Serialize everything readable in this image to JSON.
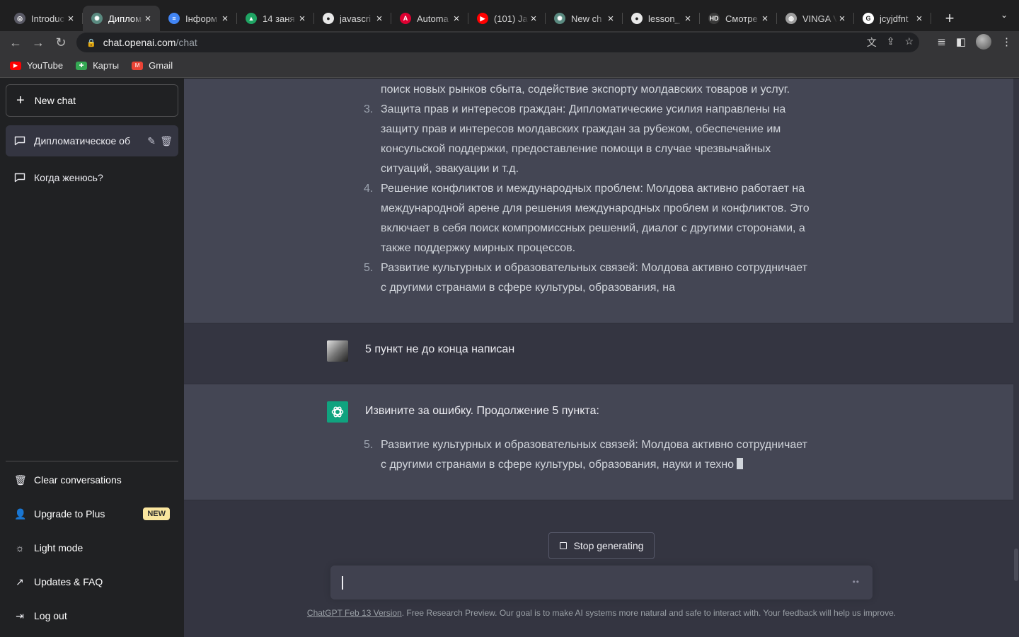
{
  "browser": {
    "tabs": [
      {
        "title": "Introduc",
        "fav_color": "#5a5a66",
        "fav_glyph": "◎",
        "active": false
      },
      {
        "title": "Диплом",
        "fav_color": "#5a8a80",
        "fav_glyph": "✺",
        "active": true
      },
      {
        "title": "Інформ",
        "fav_color": "#4285f4",
        "fav_glyph": "≡",
        "active": false
      },
      {
        "title": "14 заня",
        "fav_color": "#1fa463",
        "fav_glyph": "▲",
        "active": false
      },
      {
        "title": "javascri",
        "fav_color": "#e8e8e8",
        "fav_glyph": "●",
        "active": false
      },
      {
        "title": "Automa",
        "fav_color": "#dd0031",
        "fav_glyph": "A",
        "active": false
      },
      {
        "title": "(101) Ja",
        "fav_color": "#ff0000",
        "fav_glyph": "▶",
        "active": false
      },
      {
        "title": "New ch",
        "fav_color": "#5a8a80",
        "fav_glyph": "✺",
        "active": false
      },
      {
        "title": "lesson_",
        "fav_color": "#e8e8e8",
        "fav_glyph": "●",
        "active": false
      },
      {
        "title": "Смотре",
        "fav_color": "#3a3a3a",
        "fav_glyph": "HD",
        "active": false
      },
      {
        "title": "VINGA V",
        "fav_color": "#9e9e9e",
        "fav_glyph": "◍",
        "active": false
      },
      {
        "title": "jcyjdfnt",
        "fav_color": "#ffffff",
        "fav_glyph": "G",
        "active": false
      }
    ],
    "url_host": "chat.openai.com",
    "url_path": "/chat",
    "bookmarks": [
      {
        "label": "YouTube",
        "color": "#ff0000",
        "glyph": "▶"
      },
      {
        "label": "Карты",
        "color": "#34a853",
        "glyph": "✚"
      },
      {
        "label": "Gmail",
        "color": "#ea4335",
        "glyph": "M"
      }
    ]
  },
  "sidebar": {
    "new_chat": "New chat",
    "conversations": [
      {
        "title": "Дипломатическое об",
        "active": true
      },
      {
        "title": "Когда женюсь?",
        "active": false
      }
    ],
    "menu": [
      {
        "label": "Clear conversations",
        "icon": "🗑"
      },
      {
        "label": "Upgrade to Plus",
        "icon": "👤",
        "badge": "NEW"
      },
      {
        "label": "Light mode",
        "icon": "☼"
      },
      {
        "label": "Updates & FAQ",
        "icon": "↗"
      },
      {
        "label": "Log out",
        "icon": "⇥"
      }
    ]
  },
  "chat": {
    "top_fragment": "поиск новых рынков сбыта, содействие экспорту молдавских товаров и услуг.",
    "items": [
      {
        "num": "3.",
        "lines": [
          "Защита прав и интересов граждан: Дипломатические усилия направлены на",
          "защиту прав и интересов молдавских граждан за рубежом, обеспечение им",
          "консульской поддержки, предоставление помощи в случае чрезвычайных",
          "ситуаций, эвакуации и т.д."
        ]
      },
      {
        "num": "4.",
        "lines": [
          "Решение конфликтов и международных проблем: Молдова активно работает на",
          "международной арене для решения международных проблем и конфликтов. Это",
          "включает в себя поиск компромиссных решений, диалог с другими сторонами, а",
          "также поддержку мирных процессов."
        ]
      },
      {
        "num": "5.",
        "lines": [
          "Развитие культурных и образовательных связей: Молдова активно сотрудничает",
          "с другими странами в сфере культуры, образования, на"
        ]
      }
    ],
    "user_message": "5 пункт не до конца написан",
    "ai_intro": "Извините за ошибку. Продолжение 5 пункта:",
    "ai_item": {
      "num": "5.",
      "lines": [
        "Развитие культурных и образовательных связей: Молдова активно сотрудничает",
        "с другими странами в сфере культуры, образования, науки и техно"
      ]
    },
    "stop_button": "Stop generating",
    "input_value": "",
    "footer_link": "ChatGPT Feb 13 Version",
    "footer_text": ". Free Research Preview. Our goal is to make AI systems more natural and safe to interact with. Your feedback will help us improve."
  }
}
